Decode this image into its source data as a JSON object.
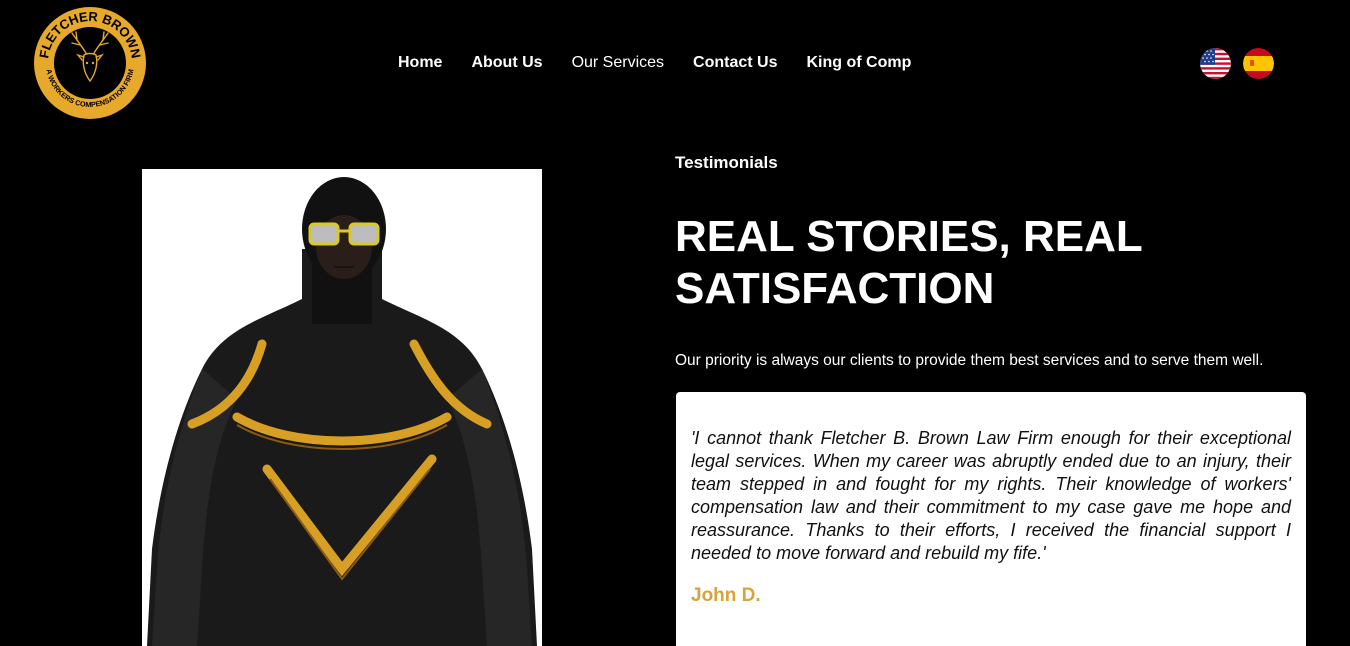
{
  "logo": {
    "top_text": "FLETCHER BROWN",
    "bottom_text": "A WORKERS COMPENSATION FIRM",
    "icon": "deer-head-icon"
  },
  "nav": {
    "items": [
      {
        "label": "Home"
      },
      {
        "label": "About Us"
      },
      {
        "label": "Our Services"
      },
      {
        "label": "Contact Us"
      },
      {
        "label": "King of Comp"
      }
    ],
    "active": "Our Services"
  },
  "languages": [
    {
      "icon": "us-flag-icon"
    },
    {
      "icon": "spain-flag-icon"
    }
  ],
  "testimonials": {
    "eyebrow": "Testimonials",
    "headline": "REAL STORIES, REAL SATISFACTION",
    "subtext": "Our priority is always our clients to provide them best services and to serve them well.",
    "quote": "'I cannot thank Fletcher B. Brown Law Firm enough for their exceptional legal services. When my career was abruptly ended due to an injury, their team stepped in and fought for my rights. Their knowledge of workers' compensation law and their commitment to my case gave me hope and reassurance. Thanks to their efforts, I received the financial support I needed to move forward and rebuild my fife.'",
    "author": "John D."
  },
  "colors": {
    "background": "#000000",
    "gold": "#e7a92b",
    "author": "#d7a33a",
    "card": "#ffffff"
  }
}
